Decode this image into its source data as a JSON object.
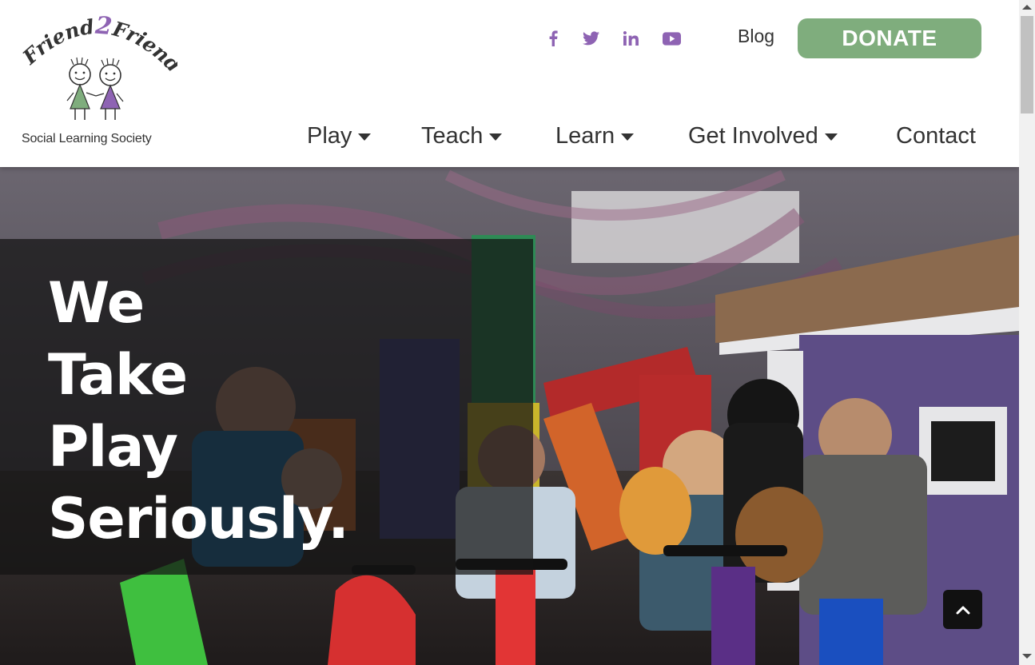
{
  "header": {
    "logo": {
      "top_text": "Friend2Friend",
      "top_text_parts": [
        "Friend",
        "2",
        "Friend"
      ],
      "subtitle": "Social Learning Society"
    },
    "social": [
      {
        "name": "facebook-icon",
        "glyph": "f"
      },
      {
        "name": "twitter-icon",
        "glyph": "twitter"
      },
      {
        "name": "linkedin-icon",
        "glyph": "in"
      },
      {
        "name": "youtube-icon",
        "glyph": "youtube"
      }
    ],
    "blog_label": "Blog",
    "donate_label": "DONATE",
    "nav": [
      {
        "label": "Play",
        "dropdown": true
      },
      {
        "label": "Teach",
        "dropdown": true
      },
      {
        "label": "Learn",
        "dropdown": true
      },
      {
        "label": "Get Involved",
        "dropdown": true
      },
      {
        "label": "Contact",
        "dropdown": false
      }
    ]
  },
  "hero": {
    "title_lines": [
      "We",
      "Take",
      "Play",
      "Seriously."
    ]
  },
  "colors": {
    "accent_purple": "#8e63b3",
    "donate_green": "#7fad7d",
    "text_dark": "#333333"
  }
}
